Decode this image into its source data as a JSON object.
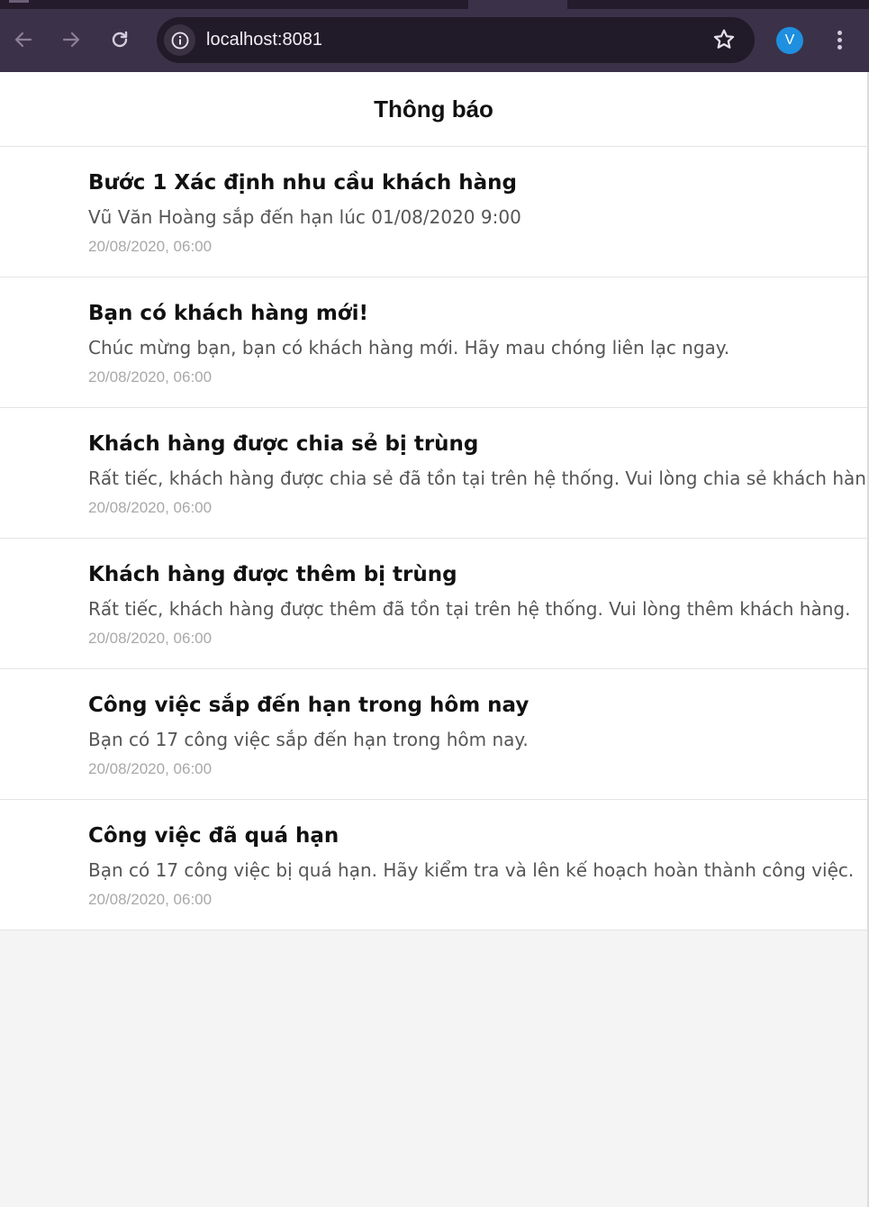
{
  "browser": {
    "url": "localhost:8081",
    "profile_initial": "V",
    "icons": {
      "back": "arrow-left-icon",
      "forward": "arrow-right-icon",
      "reload": "reload-icon",
      "info": "info-icon",
      "bookmark": "star-icon",
      "menu": "kebab-menu-icon"
    },
    "colors": {
      "chrome": "#3b3249",
      "omnibox": "#211a28",
      "avatar": "#1f8fe0"
    }
  },
  "header": {
    "title": "Thông báo"
  },
  "notifications": [
    {
      "title": "Bước 1 Xác định nhu cầu khách hàng",
      "body": "Vũ Văn Hoàng sắp đến hạn lúc 01/08/2020 9:00",
      "time": "20/08/2020, 06:00"
    },
    {
      "title": "Bạn có khách hàng mới!",
      "body": "Chúc mừng bạn, bạn có khách hàng mới. Hãy mau chóng liên lạc ngay.",
      "time": "20/08/2020, 06:00"
    },
    {
      "title": "Khách hàng được chia sẻ bị trùng",
      "body": "Rất tiếc, khách hàng được chia sẻ đã tồn tại trên hệ thống. Vui lòng chia sẻ khách hàng.",
      "time": "20/08/2020, 06:00"
    },
    {
      "title": "Khách hàng được thêm bị trùng",
      "body": "Rất tiếc, khách hàng được thêm đã tồn tại trên hệ thống. Vui lòng thêm khách hàng.",
      "time": "20/08/2020, 06:00"
    },
    {
      "title": "Công việc sắp đến hạn trong hôm nay",
      "body": "Bạn có 17 công việc sắp đến hạn trong hôm nay.",
      "time": "20/08/2020, 06:00"
    },
    {
      "title": "Công việc đã quá hạn",
      "body": "Bạn có 17 công việc bị quá hạn. Hãy kiểm tra và lên kế hoạch hoàn thành công việc.",
      "time": "20/08/2020, 06:00"
    }
  ]
}
